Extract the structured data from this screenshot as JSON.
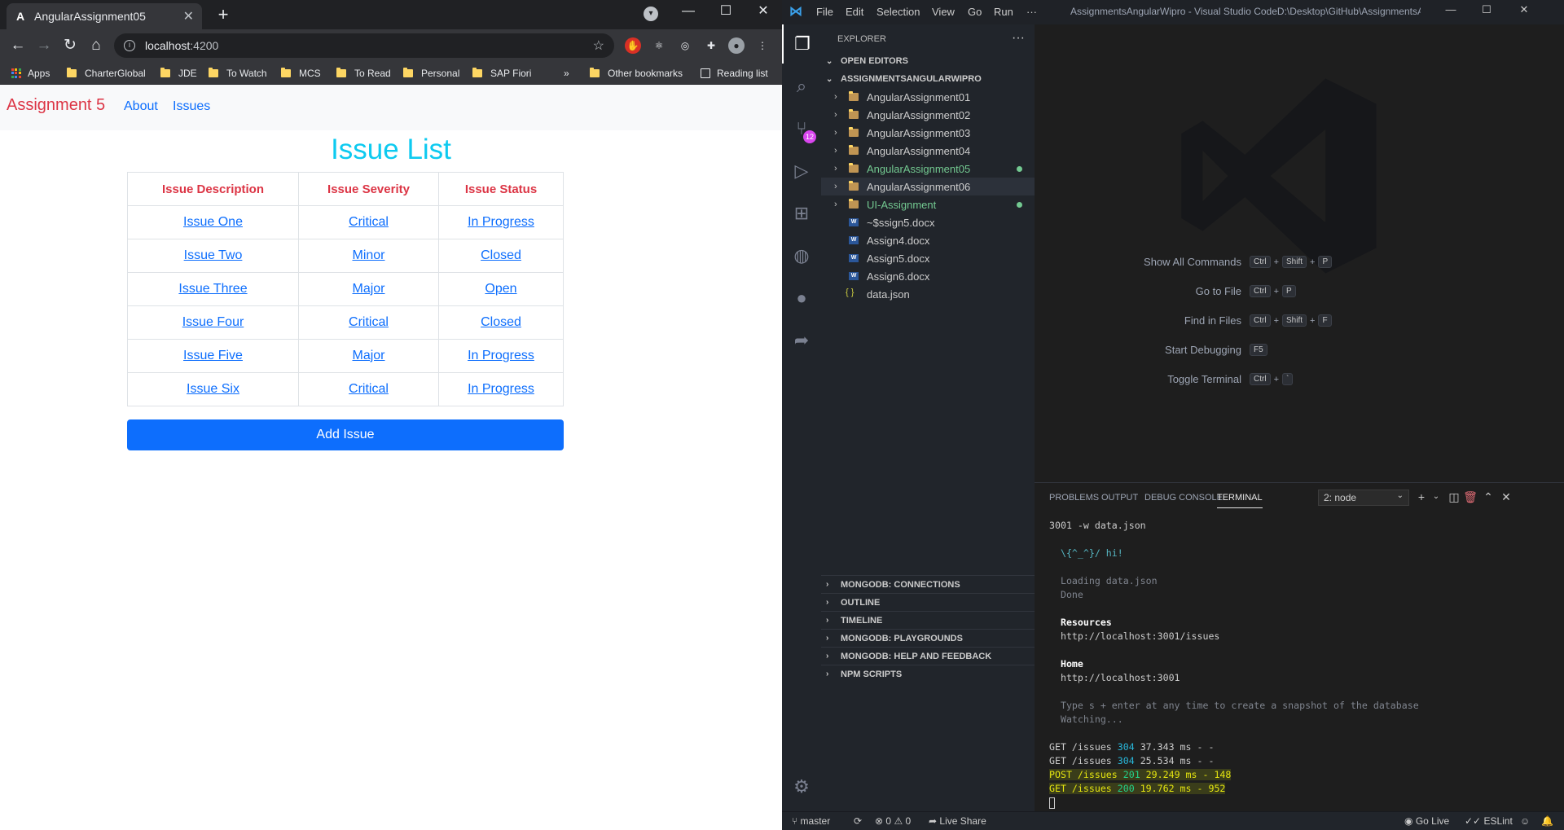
{
  "browser": {
    "tab_title": "AngularAssignment05",
    "tab_logo": "A",
    "url_host": "localhost",
    "url_port": ":4200",
    "bookmarks": [
      "Apps",
      "CharterGlobal",
      "JDE",
      "To Watch",
      "MCS",
      "To Read",
      "Personal",
      "SAP Fiori"
    ],
    "more_bookmarks": "»",
    "other_bookmarks": "Other bookmarks",
    "reading_list": "Reading list"
  },
  "app": {
    "brand": "Assignment 5",
    "nav": [
      "About",
      "Issues"
    ],
    "title": "Issue List",
    "columns": [
      "Issue Description",
      "Issue Severity",
      "Issue Status"
    ],
    "rows": [
      [
        "Issue One",
        "Critical",
        "In Progress"
      ],
      [
        "Issue Two",
        "Minor",
        "Closed"
      ],
      [
        "Issue Three",
        "Major",
        "Open"
      ],
      [
        "Issue Four",
        "Critical",
        "Closed"
      ],
      [
        "Issue Five",
        "Major",
        "In Progress"
      ],
      [
        "Issue Six",
        "Critical",
        "In Progress"
      ]
    ],
    "add_button": "Add Issue"
  },
  "vscode": {
    "menu": [
      "File",
      "Edit",
      "Selection",
      "View",
      "Go",
      "Run",
      "···"
    ],
    "window_title": "AssignmentsAngularWipro - Visual Studio CodeD:\\Desktop\\GitHub\\AssignmentsAngul...",
    "scm_badge": "12",
    "explorer_title": "EXPLORER",
    "open_editors": "OPEN EDITORS",
    "workspace": "ASSIGNMENTSANGULARWIPRO",
    "tree": [
      {
        "label": "AngularAssignment01",
        "type": "folder",
        "color": "#cccccc"
      },
      {
        "label": "AngularAssignment02",
        "type": "folder",
        "color": "#cccccc"
      },
      {
        "label": "AngularAssignment03",
        "type": "folder",
        "color": "#cccccc"
      },
      {
        "label": "AngularAssignment04",
        "type": "folder",
        "color": "#cccccc"
      },
      {
        "label": "AngularAssignment05",
        "type": "folder",
        "color": "#73c991",
        "dot": true
      },
      {
        "label": "AngularAssignment06",
        "type": "folder",
        "color": "#cccccc",
        "selected": true
      },
      {
        "label": "UI-Assignment",
        "type": "folder",
        "color": "#73c991",
        "dot": true
      },
      {
        "label": "~$ssign5.docx",
        "type": "word",
        "color": "#cccccc"
      },
      {
        "label": "Assign4.docx",
        "type": "word",
        "color": "#cccccc"
      },
      {
        "label": "Assign5.docx",
        "type": "word",
        "color": "#cccccc"
      },
      {
        "label": "Assign6.docx",
        "type": "word",
        "color": "#cccccc"
      },
      {
        "label": "data.json",
        "type": "json",
        "color": "#cccccc"
      }
    ],
    "bottom_sections": [
      "MONGODB: CONNECTIONS",
      "OUTLINE",
      "TIMELINE",
      "MONGODB: PLAYGROUNDS",
      "MONGODB: HELP AND FEEDBACK",
      "NPM SCRIPTS"
    ],
    "welcome_commands": [
      {
        "label": "Show All Commands",
        "keys": [
          "Ctrl",
          "Shift",
          "P"
        ]
      },
      {
        "label": "Go to File",
        "keys": [
          "Ctrl",
          "P"
        ]
      },
      {
        "label": "Find in Files",
        "keys": [
          "Ctrl",
          "Shift",
          "F"
        ]
      },
      {
        "label": "Start Debugging",
        "keys": [
          "F5"
        ]
      },
      {
        "label": "Toggle Terminal",
        "keys": [
          "Ctrl",
          "`"
        ]
      }
    ],
    "panel_tabs": [
      "PROBLEMS",
      "OUTPUT",
      "DEBUG CONSOLE",
      "TERMINAL"
    ],
    "terminal_select": "2: node",
    "terminal": {
      "l1": "3001 -w data.json",
      "l2": "  \\{^_^}/ hi!",
      "l3": "  Loading data.json",
      "l4": "  Done",
      "l5": "  Resources",
      "l6": "  http://localhost:3001/issues",
      "l7": "  Home",
      "l8": "  http://localhost:3001",
      "l9": "  Type s + enter at any time to create a snapshot of the database",
      "l10": "  Watching...",
      "r1a": "GET /issues ",
      "r1b": "304",
      "r1c": " 37.343 ms - -",
      "r2a": "GET /issues ",
      "r2b": "304",
      "r2c": " 25.534 ms - -",
      "r3a": "POST /issues ",
      "r3b": "201",
      "r3c": " 29.249 ms - 148",
      "r4a": "GET /issues ",
      "r4b": "200",
      "r4c": " 19.762 ms - 952"
    },
    "status": {
      "branch": "master",
      "errors": "0",
      "warnings": "0",
      "live_share": "Live Share",
      "go_live": "Go Live",
      "eslint": "ESLint"
    }
  }
}
